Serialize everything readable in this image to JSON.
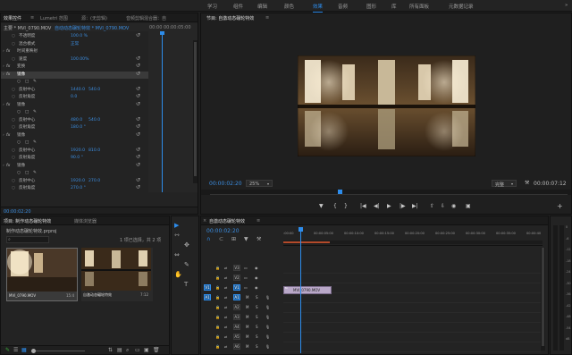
{
  "workspace_tabs": [
    "学习",
    "组件",
    "编辑",
    "颜色",
    "效果",
    "音频",
    "图形",
    "库",
    "所有面板",
    "元数据记录"
  ],
  "workspace_more": "»",
  "effect_controls": {
    "tabs": [
      "效果控件",
      "Lumetri 范围",
      "源：(无剪辑)",
      "音频剪辑混合器：自"
    ],
    "tabs_menu": "≡",
    "header_left": "主要 * MVI_0790.MOV",
    "header_right": "自动动态碾轮特效 * MVI_0790.MOV",
    "ruler_time": "00:00",
    "ruler_time_end": "00:00:05:00",
    "rows": [
      {
        "indent": 1,
        "label": "不透明度",
        "v1": "100.0 %",
        "v2": "",
        "reset": true
      },
      {
        "indent": 1,
        "label": "混合模式",
        "v1": "正常",
        "v2": "",
        "reset": false
      },
      {
        "indent": 0,
        "label": "时间重映射",
        "v1": "",
        "v2": "",
        "reset": false
      },
      {
        "indent": 1,
        "label": "速度",
        "v1": "100.00%",
        "v2": "",
        "reset": true
      },
      {
        "indent": 0,
        "label": "变换",
        "v1": "",
        "v2": "",
        "reset": true
      },
      {
        "indent": 0,
        "label": "镜像",
        "v1": "",
        "v2": "",
        "reset": true,
        "selected": true
      },
      {
        "indent": 1,
        "label": "",
        "v1": "",
        "v2": "",
        "shapes": true
      },
      {
        "indent": 1,
        "label": "反射中心",
        "v1": "1440.0",
        "v2": "540.0",
        "reset": true
      },
      {
        "indent": 1,
        "label": "反射角度",
        "v1": "0.0",
        "v2": "",
        "reset": true
      },
      {
        "indent": 0,
        "label": "镜像",
        "v1": "",
        "v2": "",
        "reset": true
      },
      {
        "indent": 1,
        "label": "",
        "v1": "",
        "v2": "",
        "shapes": true
      },
      {
        "indent": 1,
        "label": "反射中心",
        "v1": "480.0",
        "v2": "540.0",
        "reset": true
      },
      {
        "indent": 1,
        "label": "反射角度",
        "v1": "180.0 °",
        "v2": "",
        "reset": true
      },
      {
        "indent": 0,
        "label": "镜像",
        "v1": "",
        "v2": "",
        "reset": true
      },
      {
        "indent": 1,
        "label": "",
        "v1": "",
        "v2": "",
        "shapes": true
      },
      {
        "indent": 1,
        "label": "反射中心",
        "v1": "1920.0",
        "v2": "810.0",
        "reset": true
      },
      {
        "indent": 1,
        "label": "反射角度",
        "v1": "90.0 °",
        "v2": "",
        "reset": true
      },
      {
        "indent": 0,
        "label": "镜像",
        "v1": "",
        "v2": "",
        "reset": true
      },
      {
        "indent": 1,
        "label": "",
        "v1": "",
        "v2": "",
        "shapes": true
      },
      {
        "indent": 1,
        "label": "反射中心",
        "v1": "1920.0",
        "v2": "270.0",
        "reset": true
      },
      {
        "indent": 1,
        "label": "反射角度",
        "v1": "270.0 °",
        "v2": "",
        "reset": true
      }
    ],
    "fx_label": "fx",
    "footer_time": "00:00:02:20"
  },
  "program": {
    "title": "节目: 自激动态碾轮特效",
    "menu": "≡",
    "timecode": "00:00:02:20",
    "zoom": "25%",
    "quality": "完整",
    "duration": "00:00:07:12",
    "controls": [
      "marker-in",
      "mark-in",
      "mark-out",
      "go-to-in",
      "step-back",
      "play",
      "step-forward",
      "go-to-out",
      "lift",
      "extract",
      "export-frame",
      "multi"
    ],
    "control_glyphs": [
      "▼",
      "{",
      "}",
      "|◀",
      "◀|",
      "▶",
      "|▶",
      "▶|",
      "⇧",
      "⇩",
      "◉",
      "▣"
    ],
    "add": "+",
    "colors": {
      "accent": "#2d8ceb"
    }
  },
  "project": {
    "tabs": [
      "项目: 制作动态碾轮特效",
      "媒体浏览器"
    ],
    "path": "制作动态碾轮特效.prproj",
    "count": "1 项已选择，共 2 项",
    "items": [
      {
        "name": "MVI_0790.MOV",
        "dur": "15:4"
      },
      {
        "name": "自激动态碾轮特效",
        "dur": "7:12"
      }
    ],
    "bottom_icons": [
      "pencil-icon",
      "list-view-icon",
      "icon-view-icon",
      "zoom-slider",
      "folder-icon",
      "new-item-icon",
      "search-icon",
      "clear-icon"
    ]
  },
  "tools": [
    "▶",
    "⇿",
    "✥",
    "⇔",
    "✎",
    "✋",
    "T"
  ],
  "timeline": {
    "title": "自激动态碾轮特效",
    "timecode": "00:00:02:20",
    "ruler_labels": [
      ":00:00",
      "00:00:05:00",
      "00:00:10:00",
      "00:00:15:00",
      "00:00:20:00",
      "00:00:25:00",
      "00:00:30:00",
      "00:00:35:00",
      "00:00:40"
    ],
    "tracks": [
      {
        "left": "",
        "id": "V3",
        "eye": true,
        "kind": "v"
      },
      {
        "left": "",
        "id": "V2",
        "eye": true,
        "kind": "v"
      },
      {
        "left": "V1",
        "id": "V1",
        "eye": true,
        "kind": "v"
      },
      {
        "left": "A1",
        "id": "A1",
        "kind": "a"
      },
      {
        "left": "",
        "id": "A2",
        "kind": "a"
      },
      {
        "left": "",
        "id": "A3",
        "kind": "a"
      },
      {
        "left": "",
        "id": "A4",
        "kind": "a"
      },
      {
        "left": "",
        "id": "A5",
        "kind": "a"
      },
      {
        "left": "",
        "id": "A6",
        "kind": "a"
      }
    ],
    "track_m": "M",
    "track_s": "S",
    "clip": "MVI_0790.MOV",
    "meter_labels": [
      "0",
      "-6",
      "-12",
      "-18",
      "-24",
      "-30",
      "-36",
      "-42",
      "-48",
      "-54",
      "dB"
    ]
  }
}
